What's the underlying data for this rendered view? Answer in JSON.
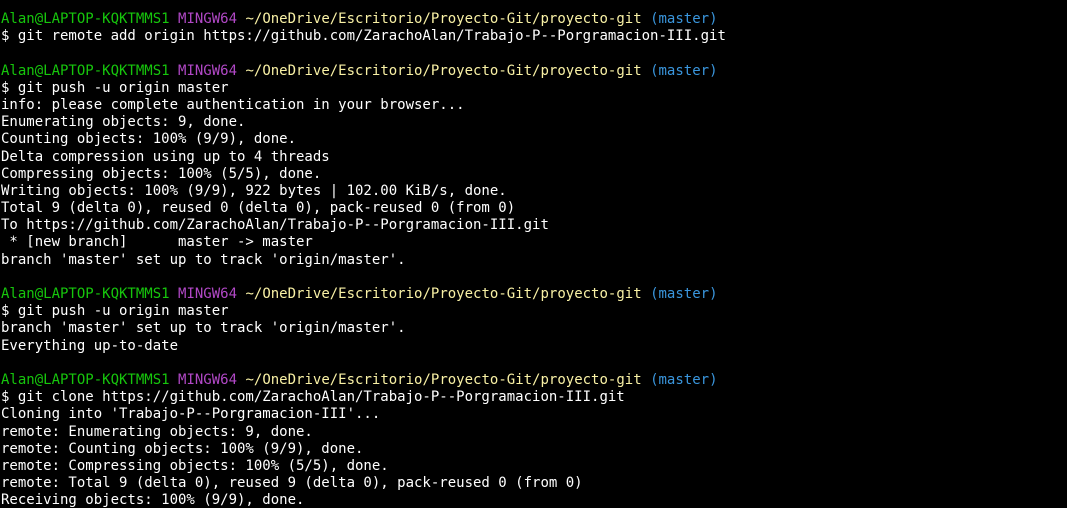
{
  "colors": {
    "background": "#000000",
    "text": "#ffffff",
    "user": "#16c60c",
    "system": "#b148c6",
    "path": "#f9f1a5",
    "branch": "#3a96dd"
  },
  "prompt": {
    "user": "Alan@LAPTOP-KQKTMMS1",
    "system": "MINGW64",
    "path": "~/OneDrive/Escritorio/Proyecto-Git/proyecto-git",
    "branch": "(master)"
  },
  "blocks": [
    {
      "command": "$ git remote add origin https://github.com/ZarachoAlan/Trabajo-P--Porgramacion-III.git",
      "output": []
    },
    {
      "command": "$ git push -u origin master",
      "output": [
        "info: please complete authentication in your browser...",
        "Enumerating objects: 9, done.",
        "Counting objects: 100% (9/9), done.",
        "Delta compression using up to 4 threads",
        "Compressing objects: 100% (5/5), done.",
        "Writing objects: 100% (9/9), 922 bytes | 102.00 KiB/s, done.",
        "Total 9 (delta 0), reused 0 (delta 0), pack-reused 0 (from 0)",
        "To https://github.com/ZarachoAlan/Trabajo-P--Porgramacion-III.git",
        " * [new branch]      master -> master",
        "branch 'master' set up to track 'origin/master'."
      ]
    },
    {
      "command": "$ git push -u origin master",
      "output": [
        "branch 'master' set up to track 'origin/master'.",
        "Everything up-to-date"
      ]
    },
    {
      "command": "$ git clone https://github.com/ZarachoAlan/Trabajo-P--Porgramacion-III.git",
      "output": [
        "Cloning into 'Trabajo-P--Porgramacion-III'...",
        "remote: Enumerating objects: 9, done.",
        "remote: Counting objects: 100% (9/9), done.",
        "remote: Compressing objects: 100% (5/5), done.",
        "remote: Total 9 (delta 0), reused 9 (delta 0), pack-reused 0 (from 0)",
        "Receiving objects: 100% (9/9), done."
      ]
    }
  ]
}
